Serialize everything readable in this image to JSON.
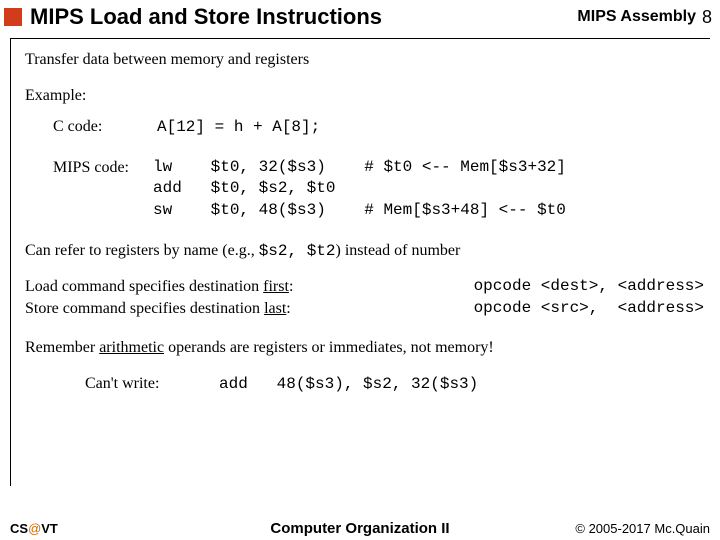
{
  "header": {
    "title": "MIPS Load and Store Instructions",
    "breadcrumb": "MIPS Assembly",
    "page": "8"
  },
  "body": {
    "intro": "Transfer data between memory and registers",
    "example_label": "Example:",
    "c_label": "C code:",
    "c_code": "A[12] = h + A[8];",
    "mips_label": "MIPS code:",
    "mips_line1": "lw    $t0, 32($s3)    # $t0 <-- Mem[$s3+32]",
    "mips_line2": "add   $t0, $s2, $t0",
    "mips_line3": "sw    $t0, 48($s3)    # Mem[$s3+48] <-- $t0",
    "note_pre": "Can refer to registers by name (e.g., ",
    "note_code": "$s2, $t2",
    "note_post": ") instead of number",
    "load_pre": "Load command specifies destination ",
    "load_u": "first",
    "load_post": ":",
    "store_pre": "Store command specifies destination ",
    "store_u": "last",
    "store_post": ":",
    "syntax_dest": "opcode <dest>, <address>",
    "syntax_src": "opcode <src>,  <address>",
    "remember_pre": "Remember ",
    "remember_u": "arithmetic",
    "remember_post": " operands are registers or immediates, not memory!",
    "cant_label": "Can't write:",
    "cant_code": "add   48($s3), $s2, 32($s3)"
  },
  "footer": {
    "left_cs": "CS",
    "left_at": "@",
    "left_vt": "VT",
    "center": "Computer Organization II",
    "right": "© 2005-2017 Mc.Quain"
  }
}
